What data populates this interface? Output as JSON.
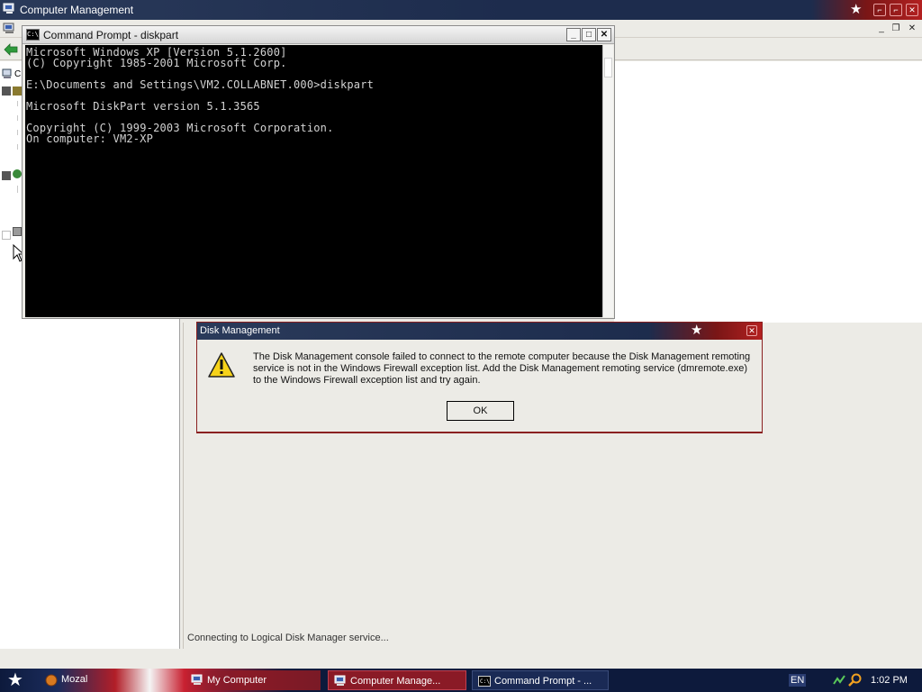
{
  "main_window": {
    "title": "Computer Management",
    "tree_partial": {
      "c_label": "C"
    },
    "status_text": "Connecting to Logical Disk Manager service..."
  },
  "cmd_window": {
    "title": "Command Prompt - diskpart",
    "icon_label": "C:\\",
    "lines": [
      "Microsoft Windows XP [Version 5.1.2600]",
      "(C) Copyright 1985-2001 Microsoft Corp.",
      "",
      "E:\\Documents and Settings\\VM2.COLLABNET.000>diskpart",
      "",
      "Microsoft DiskPart version 5.1.3565",
      "",
      "Copyright (C) 1999-2003 Microsoft Corporation.",
      "On computer: VM2-XP"
    ]
  },
  "dialog": {
    "title": "Disk Management",
    "message": "The Disk Management console failed to connect to the remote computer because the Disk Management remoting service is not in the Windows Firewall exception list.  Add the Disk Management remoting service (dmremote.exe) to the Windows Firewall exception list and try again.",
    "ok_label": "OK"
  },
  "taskbar": {
    "partial_start_text": "Mozal",
    "items": [
      {
        "label": "My Computer",
        "icon": "my-computer-icon"
      },
      {
        "label": "Computer Manage...",
        "icon": "computer-management-icon"
      },
      {
        "label": "Command Prompt - ...",
        "icon": "command-prompt-icon"
      }
    ],
    "language": "EN",
    "clock": "1:02 PM"
  },
  "colors": {
    "titlebar_navy": "#1d2c4d",
    "titlebar_red": "#b32020",
    "console_bg": "#000000",
    "console_text": "#d2d2d2"
  }
}
